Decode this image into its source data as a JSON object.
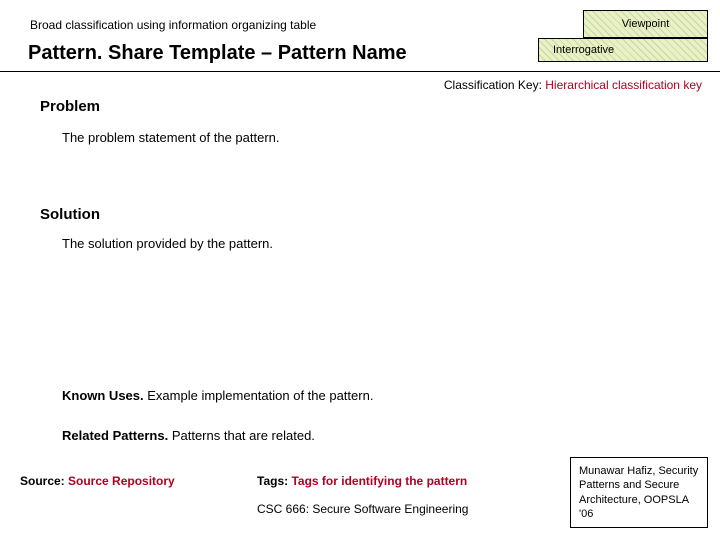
{
  "header": {
    "topline": "Broad classification using information organizing table",
    "viewpoint": "Viewpoint",
    "title": "Pattern. Share Template – Pattern Name",
    "interrogative": "Interrogative"
  },
  "classification": {
    "label": "Classification Key: ",
    "value": "Hierarchical classification key"
  },
  "problem": {
    "heading": "Problem",
    "text": "The problem statement of the pattern."
  },
  "solution": {
    "heading": "Solution",
    "text": "The solution provided by the pattern."
  },
  "known_uses": {
    "label": "Known Uses. ",
    "text": "Example implementation of the pattern."
  },
  "related_patterns": {
    "label": "Related Patterns. ",
    "text": "Patterns that are related."
  },
  "source": {
    "label": "Source: ",
    "value": "Source Repository"
  },
  "tags": {
    "label": "Tags: ",
    "value": "Tags for identifying the pattern"
  },
  "course": "CSC 666: Secure Software Engineering",
  "citation": "Munawar Hafiz, Security Patterns and Secure Architecture, OOPSLA '06"
}
